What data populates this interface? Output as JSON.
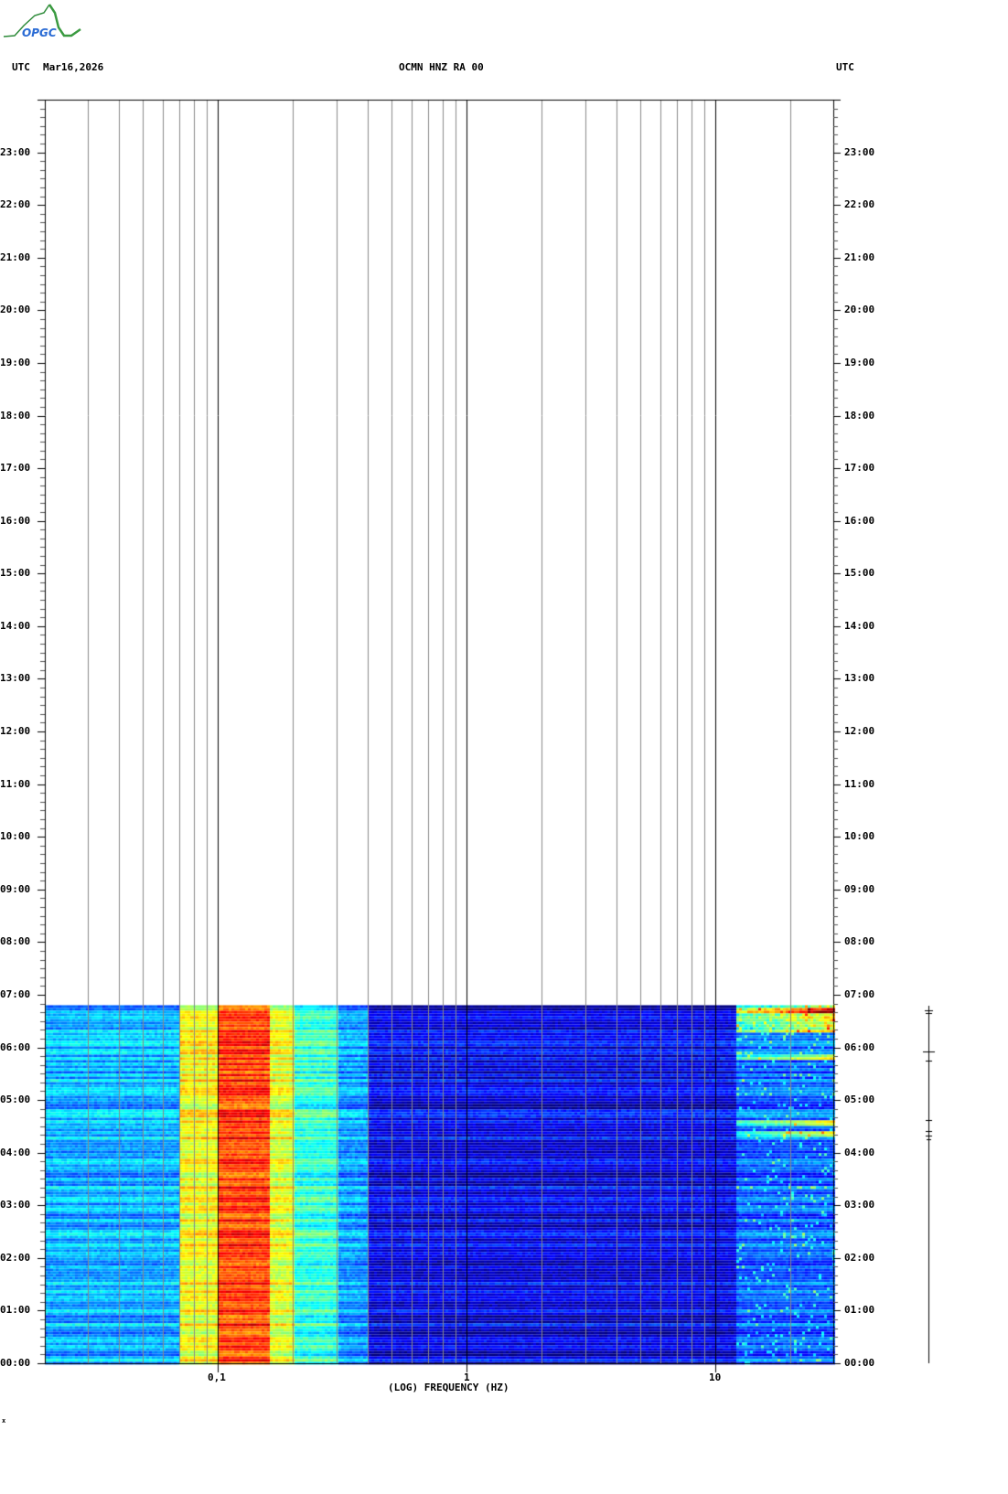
{
  "header": {
    "left_tz": "UTC",
    "date": "Mar16,2026",
    "station": "OCMN HNZ RA 00",
    "right_tz": "UTC",
    "logo_text": "OPGC"
  },
  "chart_data": {
    "type": "heatmap",
    "title": "OCMN HNZ RA 00",
    "xlabel": "(LOG) FREQUENCY (HZ)",
    "ylabel": "UTC",
    "x_scale": "log",
    "xlim": [
      0.02,
      30
    ],
    "x_tick_labels": [
      {
        "value": 0.1,
        "label": "0,1"
      },
      {
        "value": 1,
        "label": "1"
      },
      {
        "value": 10,
        "label": "10"
      }
    ],
    "y_range_hours": [
      0,
      24
    ],
    "y_tick_labels": [
      "00:00",
      "01:00",
      "02:00",
      "03:00",
      "04:00",
      "05:00",
      "06:00",
      "07:00",
      "08:00",
      "09:00",
      "10:00",
      "11:00",
      "12:00",
      "13:00",
      "14:00",
      "15:00",
      "16:00",
      "17:00",
      "18:00",
      "19:00",
      "20:00",
      "21:00",
      "22:00",
      "23:00"
    ],
    "data_end_hour": 6.8,
    "colormap": "jet",
    "bands": [
      {
        "fmin": 0.02,
        "fmax": 0.07,
        "level": 0.3
      },
      {
        "fmin": 0.07,
        "fmax": 0.1,
        "level": 0.62
      },
      {
        "fmin": 0.1,
        "fmax": 0.16,
        "level": 0.82
      },
      {
        "fmin": 0.16,
        "fmax": 0.2,
        "level": 0.6
      },
      {
        "fmin": 0.2,
        "fmax": 0.3,
        "level": 0.42
      },
      {
        "fmin": 0.3,
        "fmax": 0.4,
        "level": 0.28
      },
      {
        "fmin": 0.4,
        "fmax": 12,
        "level": 0.1
      },
      {
        "fmin": 12,
        "fmax": 30,
        "level": 0.22
      }
    ],
    "events_hours": [
      6.7,
      5.85,
      4.4,
      4.6
    ]
  }
}
